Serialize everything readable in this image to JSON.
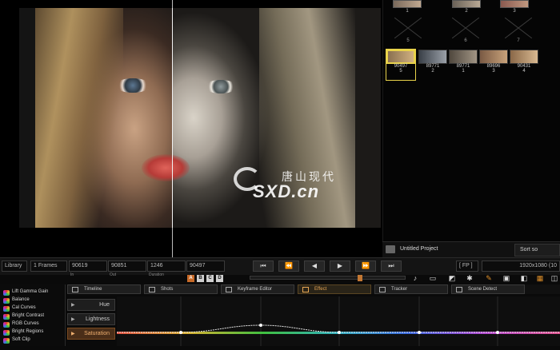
{
  "watermark": {
    "cn": "唐山现代",
    "en": "SXD.cn"
  },
  "gallery": {
    "top_stills": [
      {
        "label": "1"
      },
      {
        "label": "2"
      },
      {
        "label": "3"
      }
    ],
    "empty_slots": [
      {
        "label": "5"
      },
      {
        "label": "6"
      },
      {
        "label": "7"
      }
    ],
    "clips": [
      {
        "code": "90497",
        "num": "5",
        "selected": true
      },
      {
        "code": "89771",
        "num": "2",
        "selected": false
      },
      {
        "code": "89771",
        "num": "1",
        "selected": false
      },
      {
        "code": "89696",
        "num": "3",
        "selected": false
      },
      {
        "code": "90431",
        "num": "4",
        "selected": false
      }
    ],
    "project_name": "Untitled Project",
    "sort_label": "Sort so"
  },
  "transport": {
    "library_label": "Library",
    "frames_label": "1 Frames",
    "in_value": "90619",
    "out_value": "90851",
    "duration_value": "1246",
    "position_value": "90497",
    "in_label": "In",
    "out_label": "Out",
    "duration_label": "Duration",
    "mode_buttons": [
      "A",
      "B",
      "C",
      "D"
    ],
    "buttons": [
      "⏮",
      "⏪",
      "◀",
      "▶",
      "⏩",
      "⏭"
    ],
    "resolution": "1920x1080 (10",
    "fps_label": "[ FP ]"
  },
  "tabs": [
    {
      "label": "Timeline",
      "active": false
    },
    {
      "label": "Shots",
      "active": false
    },
    {
      "label": "Keyframe Editor",
      "active": false
    },
    {
      "label": "Effect",
      "active": true
    },
    {
      "label": "Tracker",
      "active": false
    },
    {
      "label": "Scene Detect",
      "active": false
    }
  ],
  "effects": [
    "Lift Gamma Gain",
    "Balance",
    "Cal Curves",
    "Bright Contrast",
    "RGB Curves",
    "Bright Regions",
    "Soft Clip"
  ],
  "channels": [
    {
      "label": "Hue",
      "active": false
    },
    {
      "label": "Lightness",
      "active": false
    },
    {
      "label": "Saturation",
      "active": true
    }
  ],
  "colors": {
    "accent": "#e7a653",
    "selected": "#e9d34a",
    "active_channel": "#4a2e18"
  }
}
